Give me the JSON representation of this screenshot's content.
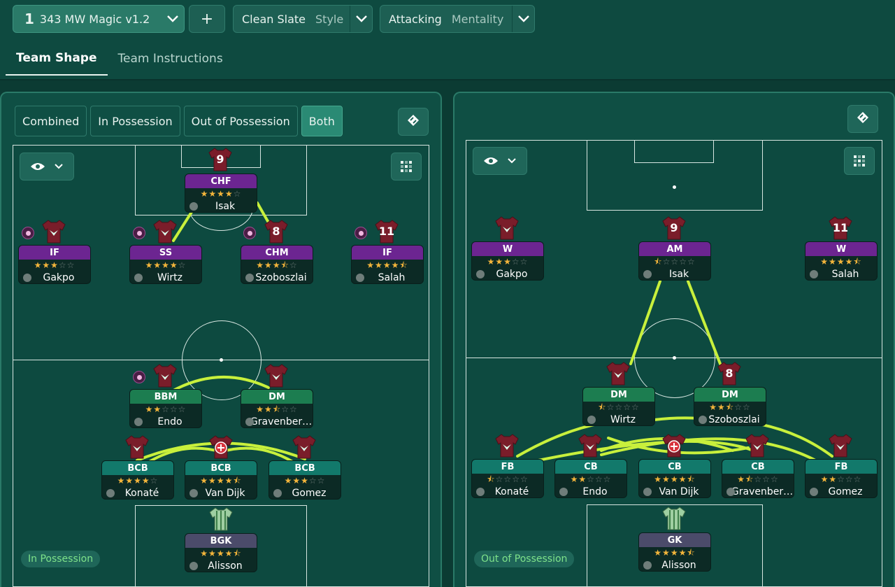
{
  "header": {
    "tactic_number": "1",
    "tactic_name": "343 MW Magic v1.2",
    "add_label": "+",
    "style_value": "Clean Slate",
    "style_label": "Style",
    "mentality_value": "Attacking",
    "mentality_label": "Mentality"
  },
  "tabs": [
    {
      "label": "Team Shape",
      "active": true
    },
    {
      "label": "Team Instructions",
      "active": false
    }
  ],
  "view_modes": [
    {
      "label": "Combined",
      "active": false
    },
    {
      "label": "In Possession",
      "active": false
    },
    {
      "label": "Out of Possession",
      "active": false
    },
    {
      "label": "Both",
      "active": true
    }
  ],
  "left_pitch": {
    "phase_label": "In Possession",
    "players": [
      {
        "role": "CHF",
        "stars": 4.0,
        "name": "Isak",
        "shirt": "9",
        "line": "att"
      },
      {
        "role": "IF",
        "stars": 3.0,
        "name": "Gakpo",
        "shirt": "",
        "line": "att"
      },
      {
        "role": "SS",
        "stars": 4.0,
        "name": "Wirtz",
        "shirt": "",
        "line": "att"
      },
      {
        "role": "CHM",
        "stars": 3.5,
        "name": "Szoboszlai",
        "shirt": "8",
        "line": "att"
      },
      {
        "role": "IF",
        "stars": 4.5,
        "name": "Salah",
        "shirt": "11",
        "line": "att"
      },
      {
        "role": "BBM",
        "stars": 2.0,
        "name": "Endo",
        "shirt": "",
        "line": "mid"
      },
      {
        "role": "DM",
        "stars": 2.5,
        "name": "Gravenber…",
        "shirt": "",
        "line": "mid"
      },
      {
        "role": "BCB",
        "stars": 4.0,
        "name": "Konaté",
        "shirt": "",
        "line": "def"
      },
      {
        "role": "BCB",
        "stars": 4.5,
        "name": "Van Dijk",
        "shirt": "",
        "line": "def"
      },
      {
        "role": "BCB",
        "stars": 3.0,
        "name": "Gomez",
        "shirt": "",
        "line": "def"
      },
      {
        "role": "BGK",
        "stars": 4.5,
        "name": "Alisson",
        "shirt": "",
        "line": "gk"
      }
    ]
  },
  "right_pitch": {
    "phase_label": "Out of Possession",
    "players": [
      {
        "role": "W",
        "stars": 3.0,
        "name": "Gakpo",
        "shirt": "",
        "line": "att"
      },
      {
        "role": "AM",
        "stars": 0.5,
        "name": "Isak",
        "shirt": "9",
        "line": "att"
      },
      {
        "role": "W",
        "stars": 4.5,
        "name": "Salah",
        "shirt": "11",
        "line": "att"
      },
      {
        "role": "DM",
        "stars": 0.5,
        "name": "Wirtz",
        "shirt": "",
        "line": "mid"
      },
      {
        "role": "DM",
        "stars": 2.5,
        "name": "Szoboszlai",
        "shirt": "8",
        "line": "mid"
      },
      {
        "role": "FB",
        "stars": 0.5,
        "name": "Konaté",
        "shirt": "",
        "line": "def"
      },
      {
        "role": "CB",
        "stars": 2.0,
        "name": "Endo",
        "shirt": "",
        "line": "def"
      },
      {
        "role": "CB",
        "stars": 4.5,
        "name": "Van Dijk",
        "shirt": "",
        "line": "def"
      },
      {
        "role": "CB",
        "stars": 1.5,
        "name": "Gravenber…",
        "shirt": "",
        "line": "def"
      },
      {
        "role": "FB",
        "stars": 2.0,
        "name": "Gomez",
        "shirt": "",
        "line": "def"
      },
      {
        "role": "GK",
        "stars": 4.5,
        "name": "Alisson",
        "shirt": "",
        "line": "gk"
      }
    ]
  },
  "colors": {
    "attack_role": "#6c2591",
    "midfield_role": "#1c7d50",
    "defence_role": "#12796b",
    "keeper_role": "#4b4b6a",
    "link": "#c8f03c",
    "star": "#f4b53b"
  },
  "icons": [
    "chevron-down-icon",
    "plus-icon",
    "eye-icon",
    "grid-icon",
    "pitch-toggle-icon",
    "person-icon",
    "trait-dot-icon"
  ]
}
